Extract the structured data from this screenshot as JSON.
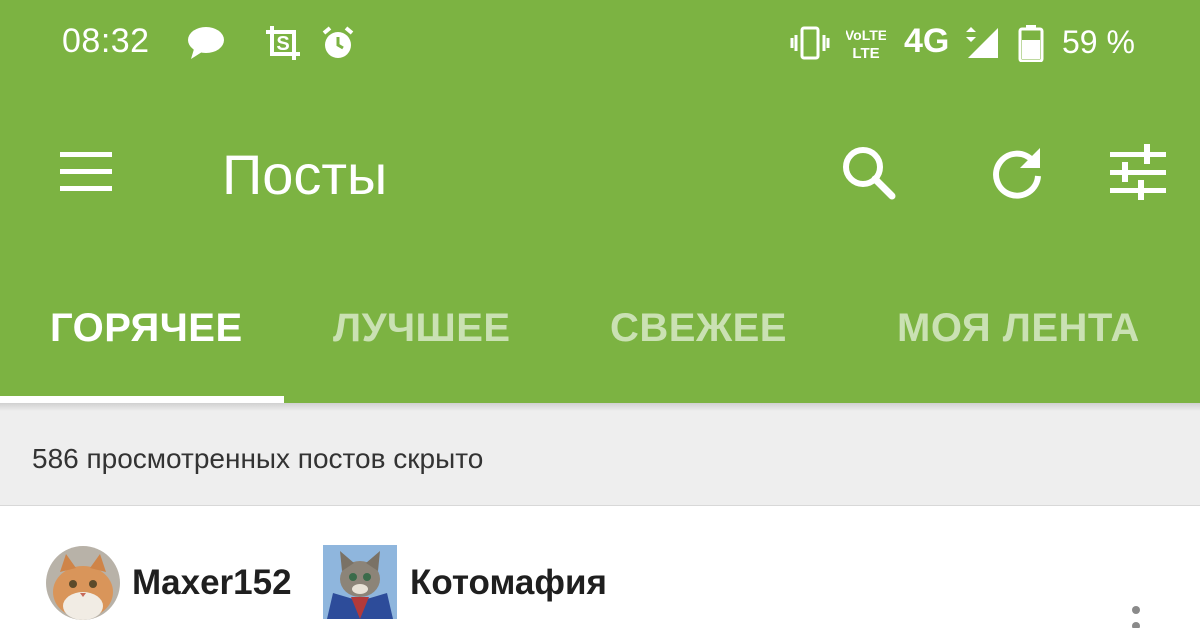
{
  "status_bar": {
    "time": "08:32",
    "network": "4G",
    "battery": "59 %",
    "icons": [
      "chat-bubble-icon",
      "screenshot-icon",
      "alarm-icon",
      "vibrate-icon",
      "volte-icon",
      "signal-icon",
      "battery-icon"
    ]
  },
  "toolbar": {
    "title": "Посты",
    "icons": [
      "menu-icon",
      "search-icon",
      "refresh-icon",
      "filter-icon"
    ]
  },
  "tabs": [
    {
      "label": "ГОРЯЧЕЕ",
      "active": true
    },
    {
      "label": "ЛУЧШЕЕ",
      "active": false
    },
    {
      "label": "СВЕЖЕЕ",
      "active": false
    },
    {
      "label": "МОЯ ЛЕНТА",
      "active": false
    }
  ],
  "hidden_notice": "586 просмотренных постов скрыто",
  "post": {
    "author": "Maxer152",
    "community": "Котомафия"
  },
  "colors": {
    "accent": "#7cb342",
    "text_dark": "#1f1f1f",
    "notice_bg": "#eeeeee"
  }
}
